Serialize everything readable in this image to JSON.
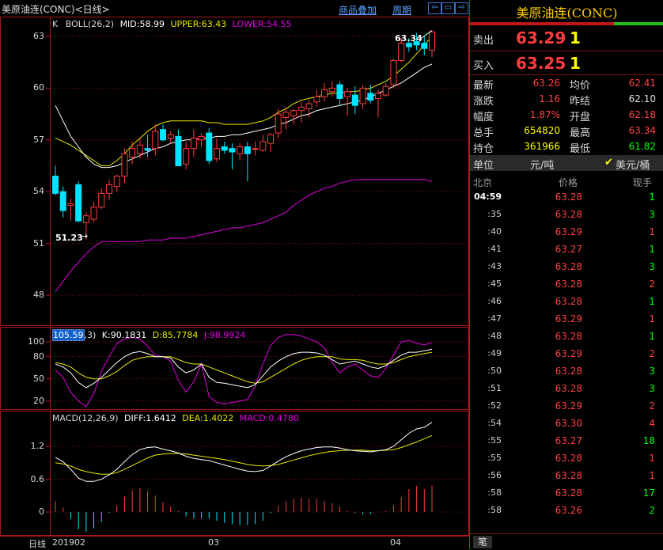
{
  "header": {
    "title": "美原油连(CONC)<日线>",
    "link_overlay": "商品叠加",
    "link_period": "周期"
  },
  "boll": {
    "label_k": "K",
    "label": "BOLL(26,2)",
    "mid": "MID:58.99",
    "upper": "UPPER:63.43",
    "lower": "LOWER:54.55",
    "high_mark": "63.34",
    "low_mark": "51.23",
    "yticks": [
      "63",
      "60",
      "57",
      "54",
      "51",
      "48"
    ]
  },
  "kdj": {
    "label_sel": "105.59",
    "label_rest": ",3)",
    "k": "K:90.1831",
    "d": "D:85.7784",
    "j": "J:98.9924",
    "yticks": [
      "100",
      "80",
      "50",
      "20"
    ]
  },
  "macd": {
    "label": "MACD(12,26,9)",
    "diff": "DIFF:1.6412",
    "dea": "DEA:1.4022",
    "macd": "MACD:0.4780",
    "yticks": [
      "1.2",
      "0.6",
      "0"
    ]
  },
  "xaxis": {
    "tag": "日线",
    "labels": [
      "201902",
      "03",
      "04"
    ]
  },
  "colors": {
    "up": "#ff3c3c",
    "down": "#00e5ff",
    "mid": "#ffffff",
    "upper": "#e8e800",
    "lower": "#e000e0"
  },
  "chart_data": {
    "type": "candlestick",
    "candles": [
      {
        "o": 54.9,
        "h": 55.5,
        "l": 53.8,
        "c": 53.9
      },
      {
        "o": 54.0,
        "h": 54.3,
        "l": 52.5,
        "c": 52.9
      },
      {
        "o": 53.2,
        "h": 53.6,
        "l": 52.3,
        "c": 53.3
      },
      {
        "o": 54.4,
        "h": 54.6,
        "l": 52.2,
        "c": 52.3
      },
      {
        "o": 52.2,
        "h": 52.8,
        "l": 51.23,
        "c": 52.6
      },
      {
        "o": 52.4,
        "h": 53.4,
        "l": 52.2,
        "c": 53.1
      },
      {
        "o": 53.1,
        "h": 54.2,
        "l": 53.0,
        "c": 53.9
      },
      {
        "o": 53.9,
        "h": 54.7,
        "l": 53.5,
        "c": 54.4
      },
      {
        "o": 54.3,
        "h": 55.0,
        "l": 54.0,
        "c": 54.9
      },
      {
        "o": 54.9,
        "h": 56.5,
        "l": 54.5,
        "c": 56.2
      },
      {
        "o": 56.0,
        "h": 56.9,
        "l": 55.6,
        "c": 56.5
      },
      {
        "o": 56.2,
        "h": 57.1,
        "l": 55.9,
        "c": 56.7
      },
      {
        "o": 56.5,
        "h": 57.3,
        "l": 56.0,
        "c": 56.4
      },
      {
        "o": 56.5,
        "h": 57.9,
        "l": 56.1,
        "c": 57.5
      },
      {
        "o": 57.6,
        "h": 57.9,
        "l": 56.9,
        "c": 57.0
      },
      {
        "o": 57.1,
        "h": 57.5,
        "l": 56.8,
        "c": 57.3
      },
      {
        "o": 57.2,
        "h": 57.6,
        "l": 55.6,
        "c": 55.5
      },
      {
        "o": 55.6,
        "h": 56.9,
        "l": 55.3,
        "c": 56.5
      },
      {
        "o": 56.5,
        "h": 57.6,
        "l": 56.0,
        "c": 57.1
      },
      {
        "o": 57.0,
        "h": 57.4,
        "l": 56.6,
        "c": 57.2
      },
      {
        "o": 57.4,
        "h": 57.7,
        "l": 55.6,
        "c": 55.8
      },
      {
        "o": 55.9,
        "h": 57.1,
        "l": 55.7,
        "c": 56.5
      },
      {
        "o": 56.6,
        "h": 56.9,
        "l": 56.2,
        "c": 56.4
      },
      {
        "o": 56.5,
        "h": 56.8,
        "l": 55.3,
        "c": 56.3
      },
      {
        "o": 56.2,
        "h": 56.8,
        "l": 55.8,
        "c": 56.6
      },
      {
        "o": 56.6,
        "h": 56.9,
        "l": 54.6,
        "c": 56.2
      },
      {
        "o": 56.5,
        "h": 56.9,
        "l": 56.1,
        "c": 56.5
      },
      {
        "o": 56.4,
        "h": 57.3,
        "l": 56.3,
        "c": 56.9
      },
      {
        "o": 56.8,
        "h": 57.4,
        "l": 56.3,
        "c": 57.3
      },
      {
        "o": 57.4,
        "h": 58.8,
        "l": 57.1,
        "c": 58.5
      },
      {
        "o": 58.3,
        "h": 58.9,
        "l": 57.6,
        "c": 58.6
      },
      {
        "o": 58.4,
        "h": 58.8,
        "l": 57.9,
        "c": 58.7
      },
      {
        "o": 58.7,
        "h": 59.2,
        "l": 58.0,
        "c": 58.9
      },
      {
        "o": 58.8,
        "h": 59.3,
        "l": 58.3,
        "c": 59.1
      },
      {
        "o": 59.2,
        "h": 59.9,
        "l": 58.9,
        "c": 59.5
      },
      {
        "o": 59.5,
        "h": 60.3,
        "l": 59.2,
        "c": 59.9
      },
      {
        "o": 59.8,
        "h": 60.4,
        "l": 59.5,
        "c": 60.0
      },
      {
        "o": 60.2,
        "h": 60.4,
        "l": 59.0,
        "c": 59.4
      },
      {
        "o": 59.5,
        "h": 60.0,
        "l": 58.4,
        "c": 59.8
      },
      {
        "o": 59.6,
        "h": 60.1,
        "l": 58.5,
        "c": 59.0
      },
      {
        "o": 59.1,
        "h": 60.2,
        "l": 58.8,
        "c": 60.0
      },
      {
        "o": 59.7,
        "h": 60.2,
        "l": 59.1,
        "c": 59.3
      },
      {
        "o": 59.4,
        "h": 59.9,
        "l": 58.3,
        "c": 59.7
      },
      {
        "o": 59.6,
        "h": 60.3,
        "l": 59.5,
        "c": 60.1
      },
      {
        "o": 60.2,
        "h": 61.7,
        "l": 60.0,
        "c": 61.6
      },
      {
        "o": 61.6,
        "h": 62.9,
        "l": 61.5,
        "c": 62.6
      },
      {
        "o": 62.6,
        "h": 62.9,
        "l": 62.1,
        "c": 62.4
      },
      {
        "o": 62.7,
        "h": 63.2,
        "l": 62.2,
        "c": 62.5
      },
      {
        "o": 62.6,
        "h": 63.0,
        "l": 61.9,
        "c": 62.3
      },
      {
        "o": 62.2,
        "h": 63.34,
        "l": 61.8,
        "c": 63.26
      }
    ],
    "mid": [
      59.0,
      58.1,
      57.2,
      56.6,
      56.0,
      55.6,
      55.4,
      55.4,
      55.5,
      55.7,
      55.9,
      56.1,
      56.3,
      56.5,
      56.6,
      56.8,
      56.9,
      57.0,
      57.0,
      57.1,
      57.1,
      57.2,
      57.2,
      57.3,
      57.3,
      57.4,
      57.5,
      57.6,
      57.7,
      57.9,
      58.0,
      58.2,
      58.4,
      58.5,
      58.7,
      58.8,
      58.9,
      59.0,
      59.1,
      59.2,
      59.3,
      59.5,
      59.7,
      59.9,
      60.1,
      60.3,
      60.6,
      60.9,
      61.2,
      61.4
    ],
    "upper": [
      57.1,
      56.9,
      56.7,
      56.4,
      56.1,
      55.8,
      55.5,
      55.5,
      55.8,
      56.2,
      56.7,
      57.1,
      57.5,
      57.8,
      58.0,
      58.1,
      58.1,
      58.1,
      58.1,
      58.1,
      58.0,
      58.0,
      57.9,
      57.9,
      57.9,
      57.9,
      58.0,
      58.1,
      58.3,
      58.6,
      58.8,
      59.1,
      59.3,
      59.4,
      59.5,
      59.6,
      59.7,
      59.7,
      59.8,
      59.8,
      59.9,
      60.0,
      60.2,
      60.4,
      60.7,
      61.1,
      61.5,
      62.0,
      62.5,
      63.0
    ],
    "lower": [
      48.2,
      48.8,
      49.4,
      49.9,
      50.4,
      50.8,
      51.1,
      51.1,
      51.1,
      51.1,
      51.1,
      51.1,
      51.2,
      51.2,
      51.2,
      51.3,
      51.3,
      51.3,
      51.4,
      51.5,
      51.6,
      51.7,
      51.8,
      51.9,
      51.9,
      52.0,
      52.1,
      52.2,
      52.4,
      52.6,
      52.8,
      53.2,
      53.5,
      53.8,
      54.0,
      54.2,
      54.3,
      54.5,
      54.6,
      54.7,
      54.7,
      54.7,
      54.7,
      54.7,
      54.7,
      54.7,
      54.7,
      54.7,
      54.7,
      54.6
    ],
    "kdj_k": [
      70,
      66,
      58,
      45,
      38,
      44,
      52,
      62,
      72,
      80,
      85,
      87,
      84,
      80,
      80,
      78,
      66,
      58,
      62,
      70,
      52,
      45,
      44,
      42,
      40,
      38,
      42,
      54,
      66,
      74,
      80,
      84,
      86,
      86,
      85,
      82,
      76,
      70,
      72,
      74,
      70,
      66,
      64,
      68,
      75,
      82,
      86,
      86,
      88,
      90
    ],
    "kdj_d": [
      72,
      70,
      66,
      58,
      52,
      50,
      50,
      54,
      60,
      68,
      75,
      78,
      80,
      80,
      80,
      80,
      76,
      72,
      70,
      70,
      66,
      62,
      58,
      54,
      50,
      46,
      44,
      46,
      52,
      58,
      64,
      70,
      75,
      78,
      80,
      80,
      80,
      77,
      76,
      76,
      75,
      72,
      70,
      70,
      72,
      76,
      80,
      82,
      84,
      86
    ],
    "kdj_j": [
      62,
      52,
      32,
      20,
      12,
      30,
      60,
      80,
      98,
      104,
      106,
      104,
      94,
      82,
      80,
      74,
      48,
      32,
      46,
      70,
      26,
      18,
      16,
      18,
      20,
      22,
      40,
      70,
      95,
      106,
      110,
      110,
      108,
      104,
      100,
      92,
      72,
      58,
      66,
      70,
      62,
      54,
      52,
      64,
      82,
      100,
      102,
      98,
      96,
      99
    ],
    "diff": [
      1.0,
      0.92,
      0.78,
      0.62,
      0.56,
      0.56,
      0.6,
      0.68,
      0.78,
      0.92,
      1.05,
      1.14,
      1.18,
      1.19,
      1.15,
      1.12,
      1.08,
      1.02,
      0.98,
      0.96,
      0.94,
      0.9,
      0.86,
      0.82,
      0.78,
      0.75,
      0.74,
      0.76,
      0.84,
      0.93,
      1.01,
      1.07,
      1.12,
      1.15,
      1.18,
      1.19,
      1.19,
      1.17,
      1.14,
      1.12,
      1.11,
      1.1,
      1.12,
      1.14,
      1.2,
      1.32,
      1.44,
      1.52,
      1.55,
      1.64
    ],
    "dea": [
      0.9,
      0.88,
      0.84,
      0.78,
      0.74,
      0.71,
      0.69,
      0.69,
      0.72,
      0.78,
      0.85,
      0.92,
      0.99,
      1.04,
      1.06,
      1.07,
      1.07,
      1.06,
      1.04,
      1.02,
      1.0,
      0.98,
      0.96,
      0.93,
      0.9,
      0.87,
      0.85,
      0.84,
      0.85,
      0.87,
      0.91,
      0.95,
      0.99,
      1.03,
      1.06,
      1.09,
      1.11,
      1.12,
      1.13,
      1.13,
      1.13,
      1.12,
      1.12,
      1.13,
      1.14,
      1.18,
      1.23,
      1.28,
      1.34,
      1.4
    ],
    "macd_hist": [
      0.2,
      0.08,
      -0.12,
      -0.32,
      -0.36,
      -0.3,
      -0.18,
      -0.02,
      0.12,
      0.28,
      0.4,
      0.44,
      0.38,
      0.3,
      0.18,
      0.1,
      0.02,
      -0.08,
      -0.12,
      -0.12,
      -0.12,
      -0.16,
      -0.2,
      -0.22,
      -0.24,
      -0.24,
      -0.22,
      -0.16,
      -0.02,
      0.12,
      0.2,
      0.24,
      0.26,
      0.24,
      0.24,
      0.2,
      0.16,
      0.1,
      0.02,
      -0.02,
      -0.04,
      -0.04,
      0.0,
      0.02,
      0.12,
      0.28,
      0.42,
      0.48,
      0.42,
      0.48
    ],
    "price_range": [
      46.3,
      64.1
    ],
    "kdj_range": [
      10,
      115
    ],
    "macd_range": [
      -0.42,
      1.78
    ]
  },
  "panel": {
    "title": "美原油连(CONC)",
    "sell_label": "卖出",
    "sell_price": "63.29",
    "sell_qty": "1",
    "buy_label": "买入",
    "buy_price": "63.25",
    "buy_qty": "1",
    "stats": [
      {
        "l1": "最新",
        "v1": "63.26",
        "c1": "#ff4040",
        "l2": "均价",
        "v2": "62.41",
        "c2": "#ff4040"
      },
      {
        "l1": "涨跌",
        "v1": "1.16",
        "c1": "#ff4040",
        "l2": "昨结",
        "v2": "62.10",
        "c2": "#e0e0e0"
      },
      {
        "l1": "幅度",
        "v1": "1.87%",
        "c1": "#ff4040",
        "l2": "开盘",
        "v2": "62.18",
        "c2": "#ff4040"
      },
      {
        "l1": "总手",
        "v1": "654820",
        "c1": "#ffff00",
        "l2": "最高",
        "v2": "63.34",
        "c2": "#ff4040"
      },
      {
        "l1": "持仓",
        "v1": "361966",
        "c1": "#ffff00",
        "l2": "最低",
        "v2": "61.82",
        "c2": "#00ff00"
      }
    ],
    "unit_label": "单位",
    "unit_value": "元/吨",
    "unit_check": "美元/桶",
    "trades_head": {
      "city": "北京",
      "price": "价格",
      "vol": "现手"
    },
    "trades": [
      {
        "t": "04:59",
        "p": "63.28",
        "v": "1",
        "vc": "#00ff00"
      },
      {
        "t": ":35",
        "p": "63.28",
        "v": "3",
        "vc": "#00ff00"
      },
      {
        "t": ":40",
        "p": "63.29",
        "v": "1",
        "vc": "#ff4040"
      },
      {
        "t": ":41",
        "p": "63.27",
        "v": "1",
        "vc": "#00ff00"
      },
      {
        "t": ":43",
        "p": "63.28",
        "v": "3",
        "vc": "#00ff00"
      },
      {
        "t": ":45",
        "p": "63.28",
        "v": "2",
        "vc": "#ff4040"
      },
      {
        "t": ":46",
        "p": "63.28",
        "v": "1",
        "vc": "#00ff00"
      },
      {
        "t": ":47",
        "p": "63.29",
        "v": "1",
        "vc": "#ff4040"
      },
      {
        "t": ":48",
        "p": "63.28",
        "v": "1",
        "vc": "#00ff00"
      },
      {
        "t": ":49",
        "p": "63.29",
        "v": "2",
        "vc": "#ff4040"
      },
      {
        "t": ":50",
        "p": "63.28",
        "v": "3",
        "vc": "#00ff00"
      },
      {
        "t": ":51",
        "p": "63.28",
        "v": "3",
        "vc": "#00ff00"
      },
      {
        "t": ":52",
        "p": "63.29",
        "v": "2",
        "vc": "#ff4040"
      },
      {
        "t": ":54",
        "p": "63.30",
        "v": "4",
        "vc": "#ff4040"
      },
      {
        "t": ":55",
        "p": "63.27",
        "v": "18",
        "vc": "#00ff00"
      },
      {
        "t": ":55",
        "p": "63.28",
        "v": "1",
        "vc": "#ff4040"
      },
      {
        "t": ":56",
        "p": "63.28",
        "v": "1",
        "vc": "#ff4040"
      },
      {
        "t": ":58",
        "p": "63.28",
        "v": "17",
        "vc": "#00ff00"
      },
      {
        "t": ":58",
        "p": "63.26",
        "v": "2",
        "vc": "#00ff00"
      }
    ],
    "bottom_tab": "笔"
  }
}
